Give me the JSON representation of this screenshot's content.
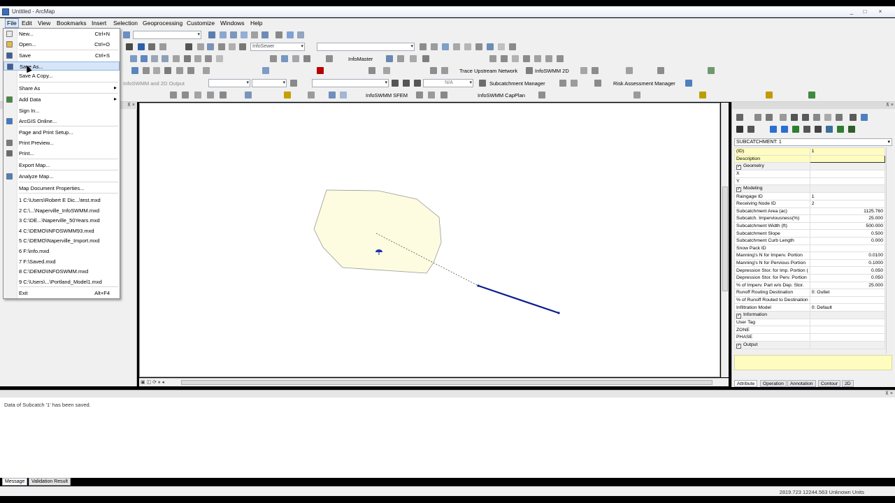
{
  "window": {
    "title": "Untitled - ArcMap",
    "controls": [
      "_",
      "□",
      "×"
    ]
  },
  "menubar": [
    "File",
    "Edit",
    "View",
    "Bookmarks",
    "Insert",
    "Selection",
    "Geoprocessing",
    "Customize",
    "Windows",
    "Help"
  ],
  "toolbars": {
    "infosewer_combo": "InfoSewer",
    "infoswmm_2d_output": "InfoSWMM and 2D Output",
    "na_value": "N/A",
    "infomaster": "InfoMaster",
    "trace_upstream": "Trace Upstream Network",
    "infoswmm_2d": "InfoSWMM 2D",
    "subcatchment_manager": "Subcatchment Manager",
    "risk_assessment_manager": "Risk Assessment Manager",
    "infoswmm_sfem": "InfoSWMM SFEM",
    "infoswmm_capplan": "InfoSWMM CapPlan"
  },
  "file_menu": {
    "items": [
      {
        "label": "New...",
        "shortcut": "Ctrl+N",
        "icon": "new-document-icon"
      },
      {
        "label": "Open...",
        "shortcut": "Ctrl+O",
        "icon": "open-folder-icon"
      },
      {
        "label": "Save",
        "shortcut": "Ctrl+S",
        "icon": "save-icon"
      },
      {
        "label": "Save As...",
        "shortcut": "",
        "icon": "save-as-icon"
      },
      {
        "label": "Save A Copy...",
        "shortcut": "",
        "icon": ""
      },
      {
        "label": "Share As",
        "shortcut": "",
        "icon": ""
      },
      {
        "label": "Add Data",
        "shortcut": "",
        "icon": "add-data-icon"
      },
      {
        "label": "Sign In...",
        "shortcut": "",
        "icon": ""
      },
      {
        "label": "ArcGIS Online...",
        "shortcut": "",
        "icon": "globe-icon"
      },
      {
        "label": "Page and Print Setup...",
        "shortcut": "",
        "icon": ""
      },
      {
        "label": "Print Preview...",
        "shortcut": "",
        "icon": "print-preview-icon"
      },
      {
        "label": "Print...",
        "shortcut": "",
        "icon": "print-icon"
      },
      {
        "label": "Export Map...",
        "shortcut": "",
        "icon": ""
      },
      {
        "label": "Analyze Map...",
        "shortcut": "",
        "icon": "analyze-icon"
      },
      {
        "label": "Map Document Properties...",
        "shortcut": "",
        "icon": ""
      }
    ],
    "recent": [
      "1 C:\\Users\\Robert E Dic...\\test.mxd",
      "2 C:\\...\\Naperville_InfoSWMM.mxd",
      "3 C:\\DE...\\Naperville_50Years.mxd",
      "4 C:\\DEMO\\INFOSWMM93.mxd",
      "5 C:\\DEMO\\Naperville_Import.mxd",
      "6 F:\\info.mxd",
      "7 F:\\Saved.mxd",
      "8 C:\\DEMO\\INFOSWMM.mxd",
      "9 C:\\Users\\...\\Portland_Model1.mxd"
    ],
    "exit": {
      "label": "Exit",
      "shortcut": "Alt+F4"
    }
  },
  "attribute_browser": {
    "selected": "SUBCATCHMENT: 1",
    "rows": [
      {
        "k": "(ID)",
        "v": "1",
        "type": "hl"
      },
      {
        "k": "Description",
        "v": "",
        "type": "hl"
      },
      {
        "k": "Geometry",
        "v": "",
        "type": "grp"
      },
      {
        "k": "X",
        "v": "",
        "type": ""
      },
      {
        "k": "Y",
        "v": "",
        "type": ""
      },
      {
        "k": "Modeling",
        "v": "",
        "type": "grp"
      },
      {
        "k": "Raingage ID",
        "v": "1",
        "type": ""
      },
      {
        "k": "Receiving Node ID",
        "v": "2",
        "type": ""
      },
      {
        "k": "Subcatchment Area (ac)",
        "v": "1125.760",
        "type": "num"
      },
      {
        "k": "Subcatch. Imperviousness(%)",
        "v": "25.000",
        "type": "num"
      },
      {
        "k": "Subcatchment Width (ft)",
        "v": "500.000",
        "type": "num"
      },
      {
        "k": "Subcatchment Slope",
        "v": "0.500",
        "type": "num"
      },
      {
        "k": "Subcatchment Curb Length",
        "v": "0.000",
        "type": "num"
      },
      {
        "k": "Snow Pack ID",
        "v": "",
        "type": ""
      },
      {
        "k": "Manning's N for Imperv. Portion",
        "v": "0.0100",
        "type": "num"
      },
      {
        "k": "Manning's N for Pervious Portion",
        "v": "0.1000",
        "type": "num"
      },
      {
        "k": "Depression Stor. for Imp. Portion (",
        "v": "0.050",
        "type": "num"
      },
      {
        "k": "Depression Stor. for Perv. Portion",
        "v": "0.050",
        "type": "num"
      },
      {
        "k": "% of Imperv. Part w/o Dep. Stor.",
        "v": "25.000",
        "type": "num"
      },
      {
        "k": "Runoff Routing Destination",
        "v": "0: Outlet",
        "type": ""
      },
      {
        "k": "% of Runoff Routed to Destination",
        "v": "",
        "type": ""
      },
      {
        "k": "Infiltration Model",
        "v": "0: Default",
        "type": ""
      },
      {
        "k": "Information",
        "v": "",
        "type": "grp"
      },
      {
        "k": "User Tag",
        "v": "",
        "type": ""
      },
      {
        "k": "ZONE",
        "v": "",
        "type": ""
      },
      {
        "k": "PHASE",
        "v": "",
        "type": ""
      },
      {
        "k": "Output",
        "v": "",
        "type": "grp"
      }
    ],
    "tabs": [
      "Attribute",
      "Operation",
      "Annotation",
      "Contour",
      "2D"
    ]
  },
  "message_panel": {
    "message": "Data of Subcatch '1' has been saved.",
    "tabs": [
      "Message",
      "Validation Result"
    ]
  },
  "statusbar": {
    "coords": "2819.723  12244.563 Unknown Units"
  },
  "colors": {
    "subcatchment_fill": "#fdfbe0",
    "conduit": "#0a1d8c",
    "menu_highlight": "#d6e6f8"
  }
}
